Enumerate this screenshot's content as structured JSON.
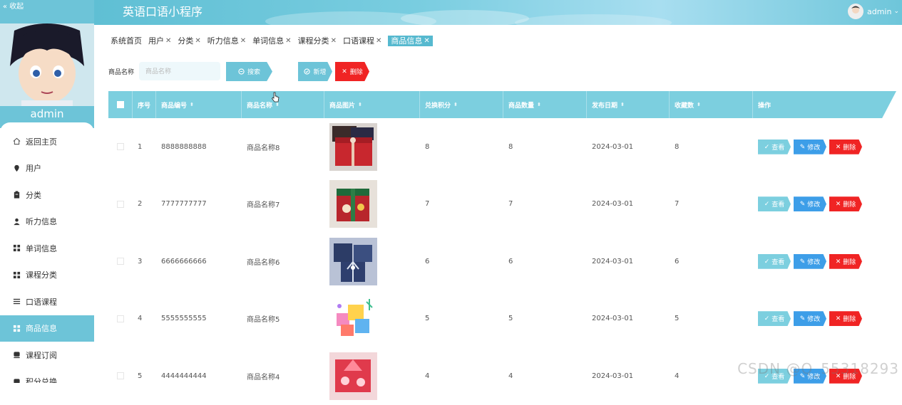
{
  "sidebar": {
    "collapse_label": "« 收起",
    "profile_name": "admin",
    "items": [
      {
        "label": "返回主页",
        "icon": "home-icon",
        "active": false
      },
      {
        "label": "用户",
        "icon": "pin-icon",
        "active": false
      },
      {
        "label": "分类",
        "icon": "clipboard-icon",
        "active": false
      },
      {
        "label": "听力信息",
        "icon": "user-icon",
        "active": false
      },
      {
        "label": "单词信息",
        "icon": "grid-icon",
        "active": false
      },
      {
        "label": "课程分类",
        "icon": "grid-icon",
        "active": false
      },
      {
        "label": "口语课程",
        "icon": "list-icon",
        "active": false
      },
      {
        "label": "商品信息",
        "icon": "grid-icon",
        "active": true
      },
      {
        "label": "课程订阅",
        "icon": "database-icon",
        "active": false
      },
      {
        "label": "积分兑换",
        "icon": "database-icon",
        "active": false
      }
    ]
  },
  "header": {
    "title": "英语口语小程序",
    "user": "admin"
  },
  "tabs": [
    {
      "label": "系统首页",
      "closable": false,
      "active": false
    },
    {
      "label": "用户",
      "closable": true,
      "active": false
    },
    {
      "label": "分类",
      "closable": true,
      "active": false
    },
    {
      "label": "听力信息",
      "closable": true,
      "active": false
    },
    {
      "label": "单词信息",
      "closable": true,
      "active": false
    },
    {
      "label": "课程分类",
      "closable": true,
      "active": false
    },
    {
      "label": "口语课程",
      "closable": true,
      "active": false
    },
    {
      "label": "商品信息",
      "closable": true,
      "active": true
    }
  ],
  "search": {
    "label": "商品名称",
    "placeholder": "商品名称",
    "search_button": "搜索",
    "add_button": "新增",
    "delete_button": "删除"
  },
  "table": {
    "columns": [
      "序号",
      "商品编号",
      "商品名称",
      "商品图片",
      "兑换积分",
      "商品数量",
      "发布日期",
      "收藏数",
      "操作"
    ],
    "rows": [
      {
        "index": "1",
        "code": "8888888888",
        "name": "商品名称8",
        "points": "8",
        "qty": "8",
        "date": "2024-03-01",
        "fav": "8"
      },
      {
        "index": "2",
        "code": "7777777777",
        "name": "商品名称7",
        "points": "7",
        "qty": "7",
        "date": "2024-03-01",
        "fav": "7"
      },
      {
        "index": "3",
        "code": "6666666666",
        "name": "商品名称6",
        "points": "6",
        "qty": "6",
        "date": "2024-03-01",
        "fav": "6"
      },
      {
        "index": "4",
        "code": "5555555555",
        "name": "商品名称5",
        "points": "5",
        "qty": "5",
        "date": "2024-03-01",
        "fav": "5"
      },
      {
        "index": "5",
        "code": "4444444444",
        "name": "商品名称4",
        "points": "4",
        "qty": "4",
        "date": "2024-03-01",
        "fav": "4"
      }
    ],
    "actions": {
      "view": "查看",
      "edit": "修改",
      "delete": "删除"
    }
  },
  "watermark": "CSDN @Q_55318293",
  "colors": {
    "accent": "#6dc4d8",
    "danger": "#f02424",
    "edit": "#3d9ee8"
  }
}
